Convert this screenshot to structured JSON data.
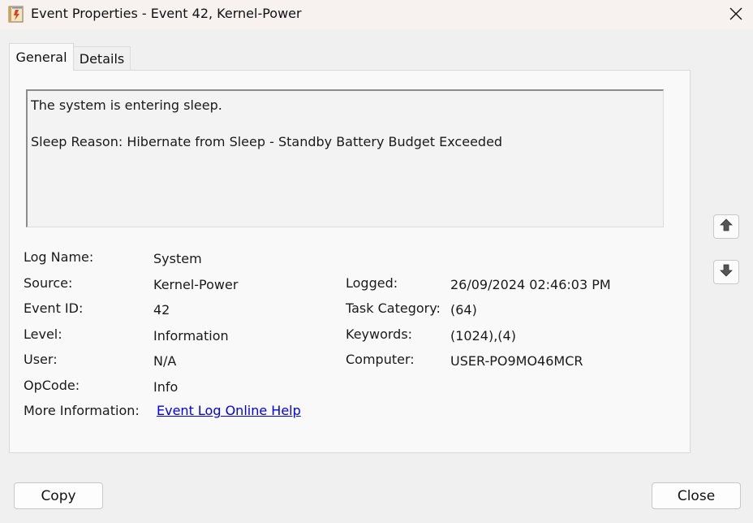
{
  "window": {
    "title": "Event Properties - Event 42, Kernel-Power"
  },
  "tabs": [
    {
      "label": "General",
      "active": true
    },
    {
      "label": "Details",
      "active": false
    }
  ],
  "description": {
    "line1": "The system is entering sleep.",
    "line2": "Sleep Reason: Hibernate from Sleep - Standby Battery Budget Exceeded"
  },
  "fields": {
    "log_name": {
      "label": "Log Name:",
      "value": "System"
    },
    "source": {
      "label": "Source:",
      "value": "Kernel-Power"
    },
    "event_id": {
      "label": "Event ID:",
      "value": "42"
    },
    "level": {
      "label": "Level:",
      "value": "Information"
    },
    "user": {
      "label": "User:",
      "value": "N/A"
    },
    "opcode": {
      "label": "OpCode:",
      "value": "Info"
    },
    "more_info": {
      "label": "More Information:",
      "value": "Event Log Online Help"
    },
    "logged": {
      "label": "Logged:",
      "value": "26/09/2024 02:46:03 PM"
    },
    "task_category": {
      "label": "Task Category:",
      "value": "(64)"
    },
    "keywords": {
      "label": "Keywords:",
      "value": "(1024),(4)"
    },
    "computer": {
      "label": "Computer:",
      "value": "USER-PO9MO46MCR"
    }
  },
  "buttons": {
    "copy": "Copy",
    "close": "Close"
  },
  "colors": {
    "link": "#0000ee",
    "titlebar": "#f7f2ef",
    "window_bg": "#f0f0f0"
  },
  "icons": {
    "app": "event-viewer-icon",
    "close": "close-icon",
    "up": "arrow-up-icon",
    "down": "arrow-down-icon"
  }
}
